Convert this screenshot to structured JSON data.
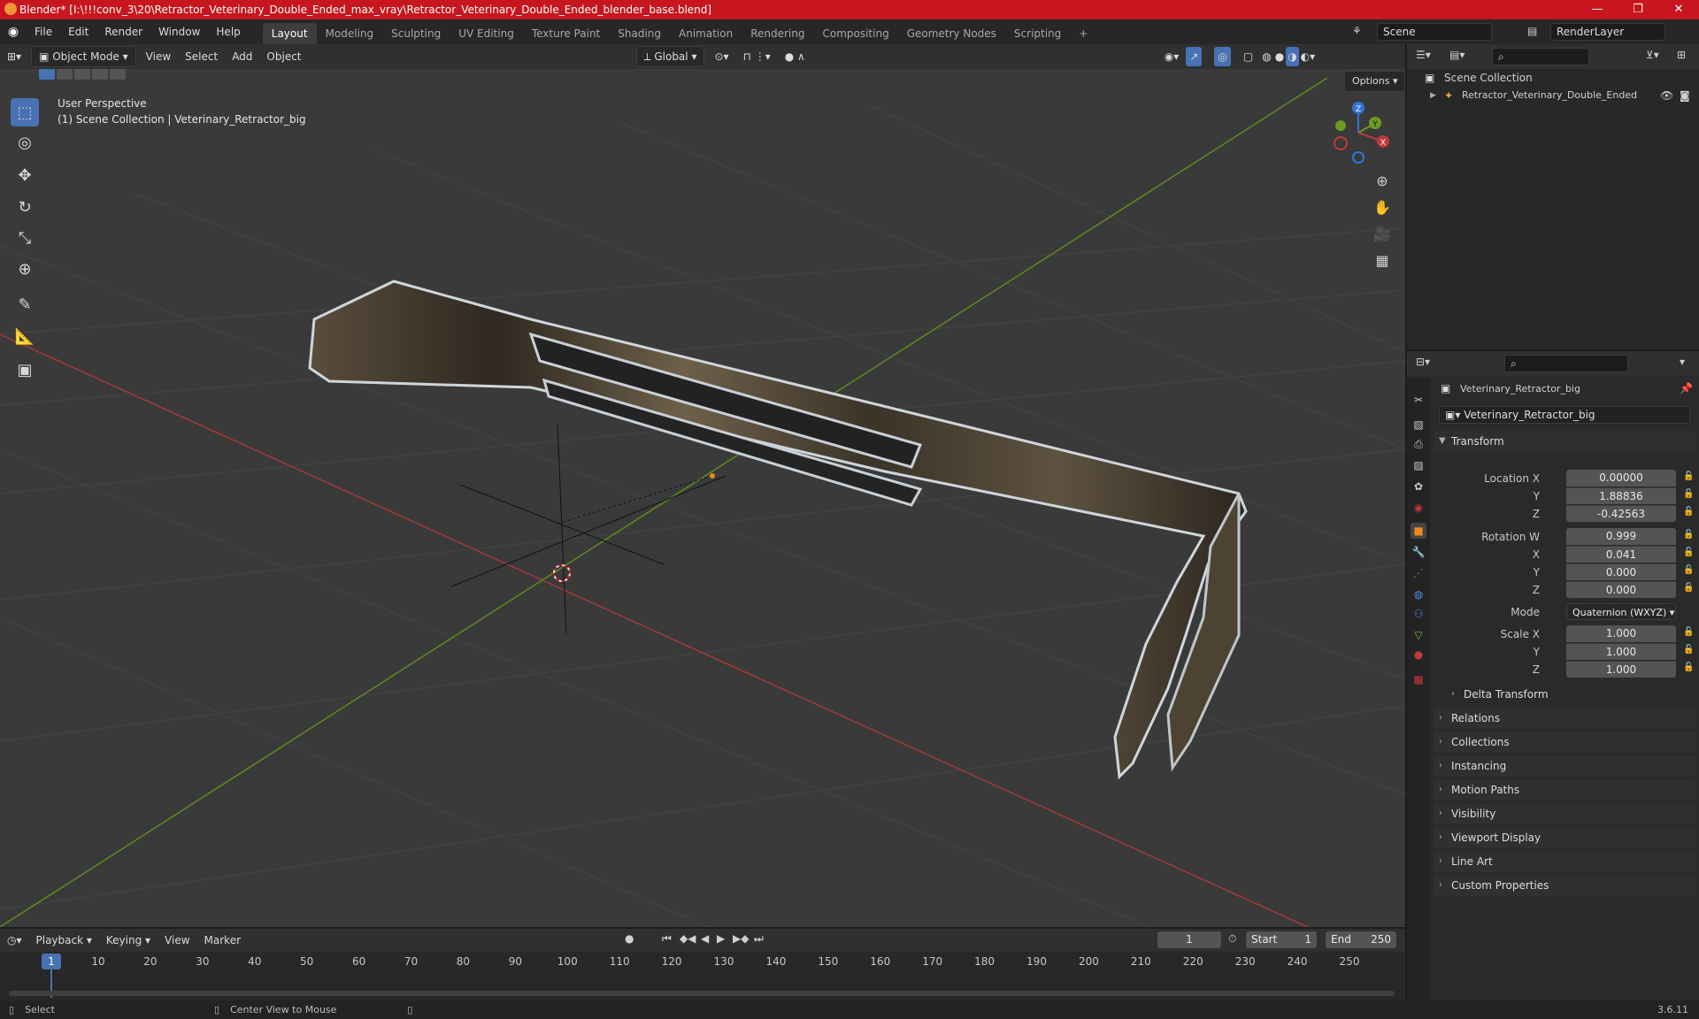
{
  "window": {
    "title": "Blender* [I:\\!!!conv_3\\20\\Retractor_Veterinary_Double_Ended_max_vray\\Retractor_Veterinary_Double_Ended_blender_base.blend]",
    "minimize": "—",
    "maximize": "❐",
    "close": "✕"
  },
  "menu": {
    "file": "File",
    "edit": "Edit",
    "render": "Render",
    "window": "Window",
    "help": "Help"
  },
  "workspaces": [
    "Layout",
    "Modeling",
    "Sculpting",
    "UV Editing",
    "Texture Paint",
    "Shading",
    "Animation",
    "Rendering",
    "Compositing",
    "Geometry Nodes",
    "Scripting"
  ],
  "workspace_add": "+",
  "scene": {
    "name": "Scene",
    "view_layer": "RenderLayer"
  },
  "viewport_header": {
    "mode": "Object Mode",
    "view": "View",
    "select": "Select",
    "add": "Add",
    "object": "Object",
    "orientation": "Global",
    "options": "Options"
  },
  "viewport": {
    "perspective": "User Perspective",
    "collection_info": "(1) Scene Collection | Veterinary_Retractor_big",
    "gizmo_x": "X",
    "gizmo_y": "Y",
    "gizmo_z": "Z"
  },
  "outliner": {
    "root": "Scene Collection",
    "object": "Retractor_Veterinary_Double_Ended"
  },
  "properties": {
    "object_name": "Veterinary_Retractor_big",
    "data_name": "Veterinary_Retractor_big",
    "transform_label": "Transform",
    "location_label": "Location X",
    "location": {
      "x": "0.00000",
      "y": "1.88836",
      "z": "-0.42563"
    },
    "rotation_label": "Rotation W",
    "rotation": {
      "w": "0.999",
      "x": "0.041",
      "y": "0.000",
      "z": "0.000"
    },
    "mode_label": "Mode",
    "mode_value": "Quaternion (WXYZ)",
    "scale_label": "Scale X",
    "scale": {
      "x": "1.000",
      "y": "1.000",
      "z": "1.000"
    },
    "axis_y": "Y",
    "axis_z": "Z",
    "axis_x": "X",
    "delta_transform": "Delta Transform",
    "sections": [
      "Relations",
      "Collections",
      "Instancing",
      "Motion Paths",
      "Visibility",
      "Viewport Display",
      "Line Art",
      "Custom Properties"
    ]
  },
  "timeline": {
    "playback": "Playback",
    "keying": "Keying",
    "view": "View",
    "marker": "Marker",
    "current_frame": "1",
    "start_label": "Start",
    "start": "1",
    "end_label": "End",
    "end": "250",
    "ticks": [
      "1",
      "10",
      "20",
      "30",
      "40",
      "50",
      "60",
      "70",
      "80",
      "90",
      "100",
      "110",
      "120",
      "130",
      "140",
      "150",
      "160",
      "170",
      "180",
      "190",
      "200",
      "210",
      "220",
      "230",
      "240",
      "250"
    ]
  },
  "status": {
    "select": "Select",
    "center_view": "Center View to Mouse",
    "version": "3.6.11"
  },
  "colors": {
    "title_bar": "#c7161d",
    "accent": "#4772b3",
    "x_axis": "#c0393b",
    "y_axis": "#6c9a22",
    "z_axis": "#2f76d8"
  }
}
